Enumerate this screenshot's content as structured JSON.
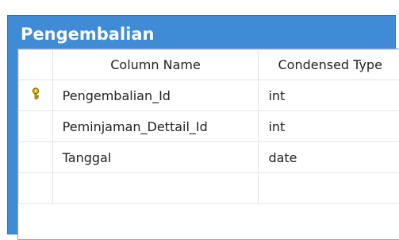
{
  "table": {
    "title": "Pengembalian",
    "columns": {
      "name": "Column Name",
      "type": "Condensed Type"
    },
    "rows": [
      {
        "name": "Pengembalian_Id",
        "type": "int",
        "primary_key": true,
        "key_icon": "key-icon"
      },
      {
        "name": "Peminjaman_Dettail_Id",
        "type": "int",
        "primary_key": false
      },
      {
        "name": "Tanggal",
        "type": "date",
        "primary_key": false
      },
      {
        "name": "",
        "type": "",
        "primary_key": false
      }
    ]
  },
  "top_glyph": "ˇ",
  "colors": {
    "title_bar": "#3f8bd6",
    "key": "#c8a000"
  }
}
